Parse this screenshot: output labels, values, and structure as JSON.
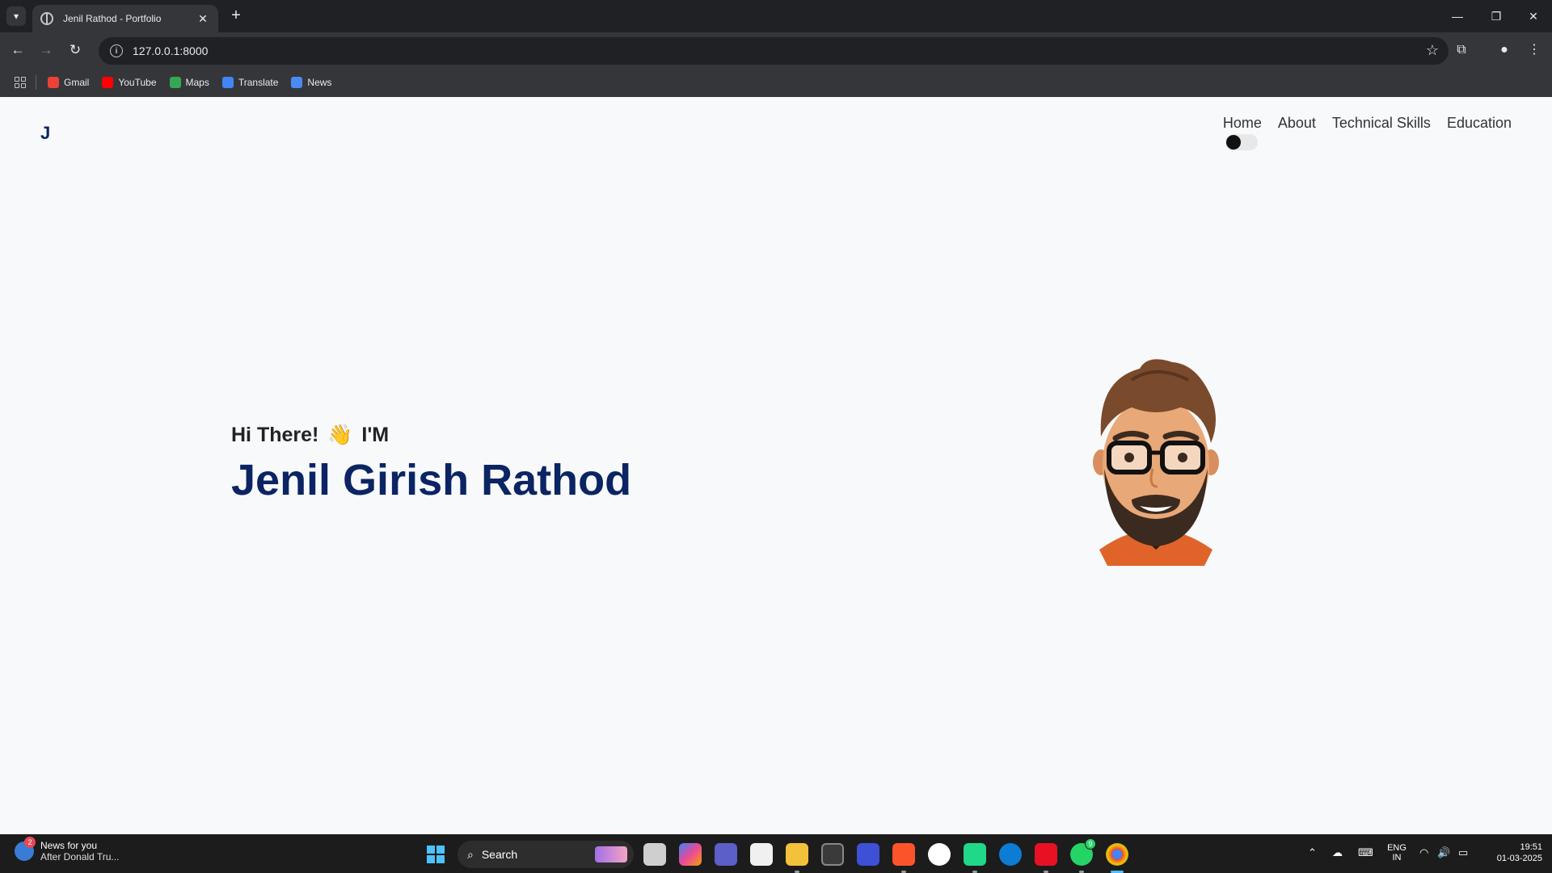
{
  "browser": {
    "tab_title": "Jenil Rathod - Portfolio",
    "url": "127.0.0.1:8000",
    "bookmarks": [
      {
        "label": "Gmail",
        "color": "#ea4335"
      },
      {
        "label": "YouTube",
        "color": "#ff0000"
      },
      {
        "label": "Maps",
        "color": "#34a853"
      },
      {
        "label": "Translate",
        "color": "#4285f4"
      },
      {
        "label": "News",
        "color": "#4a8af4"
      }
    ]
  },
  "page": {
    "logo": "J",
    "nav": [
      "Home",
      "About",
      "Technical Skills",
      "Education"
    ],
    "greeting": "Hi There!",
    "greeting_emoji": "👋",
    "greeting_suffix": "I'M",
    "name": "Jenil Girish Rathod",
    "accent_color": "#0b2463",
    "theme_toggle_on": false
  },
  "taskbar": {
    "news_title": "News for you",
    "news_subtitle": "After Donald Tru...",
    "news_badge": "2",
    "search_label": "Search",
    "whatsapp_badge": "9",
    "language_top": "ENG",
    "language_bottom": "IN",
    "time": "19:51",
    "date": "01-03-2025"
  }
}
